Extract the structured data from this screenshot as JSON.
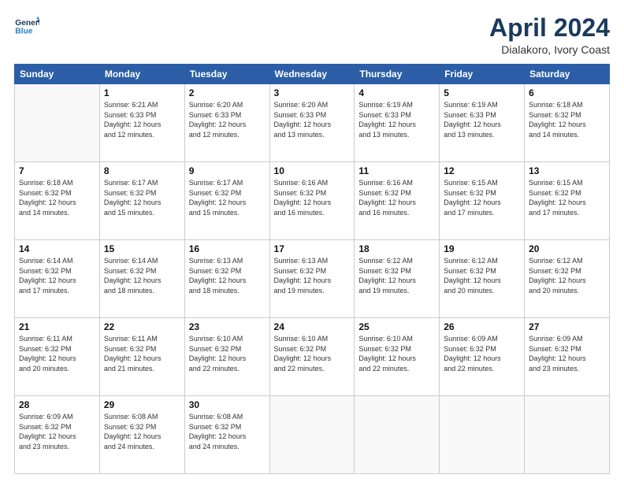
{
  "header": {
    "logo_line1": "General",
    "logo_line2": "Blue",
    "month": "April 2024",
    "location": "Dialakoro, Ivory Coast"
  },
  "weekdays": [
    "Sunday",
    "Monday",
    "Tuesday",
    "Wednesday",
    "Thursday",
    "Friday",
    "Saturday"
  ],
  "weeks": [
    [
      {
        "day": "",
        "info": ""
      },
      {
        "day": "1",
        "info": "Sunrise: 6:21 AM\nSunset: 6:33 PM\nDaylight: 12 hours\nand 12 minutes."
      },
      {
        "day": "2",
        "info": "Sunrise: 6:20 AM\nSunset: 6:33 PM\nDaylight: 12 hours\nand 12 minutes."
      },
      {
        "day": "3",
        "info": "Sunrise: 6:20 AM\nSunset: 6:33 PM\nDaylight: 12 hours\nand 13 minutes."
      },
      {
        "day": "4",
        "info": "Sunrise: 6:19 AM\nSunset: 6:33 PM\nDaylight: 12 hours\nand 13 minutes."
      },
      {
        "day": "5",
        "info": "Sunrise: 6:19 AM\nSunset: 6:33 PM\nDaylight: 12 hours\nand 13 minutes."
      },
      {
        "day": "6",
        "info": "Sunrise: 6:18 AM\nSunset: 6:32 PM\nDaylight: 12 hours\nand 14 minutes."
      }
    ],
    [
      {
        "day": "7",
        "info": "Sunrise: 6:18 AM\nSunset: 6:32 PM\nDaylight: 12 hours\nand 14 minutes."
      },
      {
        "day": "8",
        "info": "Sunrise: 6:17 AM\nSunset: 6:32 PM\nDaylight: 12 hours\nand 15 minutes."
      },
      {
        "day": "9",
        "info": "Sunrise: 6:17 AM\nSunset: 6:32 PM\nDaylight: 12 hours\nand 15 minutes."
      },
      {
        "day": "10",
        "info": "Sunrise: 6:16 AM\nSunset: 6:32 PM\nDaylight: 12 hours\nand 16 minutes."
      },
      {
        "day": "11",
        "info": "Sunrise: 6:16 AM\nSunset: 6:32 PM\nDaylight: 12 hours\nand 16 minutes."
      },
      {
        "day": "12",
        "info": "Sunrise: 6:15 AM\nSunset: 6:32 PM\nDaylight: 12 hours\nand 17 minutes."
      },
      {
        "day": "13",
        "info": "Sunrise: 6:15 AM\nSunset: 6:32 PM\nDaylight: 12 hours\nand 17 minutes."
      }
    ],
    [
      {
        "day": "14",
        "info": "Sunrise: 6:14 AM\nSunset: 6:32 PM\nDaylight: 12 hours\nand 17 minutes."
      },
      {
        "day": "15",
        "info": "Sunrise: 6:14 AM\nSunset: 6:32 PM\nDaylight: 12 hours\nand 18 minutes."
      },
      {
        "day": "16",
        "info": "Sunrise: 6:13 AM\nSunset: 6:32 PM\nDaylight: 12 hours\nand 18 minutes."
      },
      {
        "day": "17",
        "info": "Sunrise: 6:13 AM\nSunset: 6:32 PM\nDaylight: 12 hours\nand 19 minutes."
      },
      {
        "day": "18",
        "info": "Sunrise: 6:12 AM\nSunset: 6:32 PM\nDaylight: 12 hours\nand 19 minutes."
      },
      {
        "day": "19",
        "info": "Sunrise: 6:12 AM\nSunset: 6:32 PM\nDaylight: 12 hours\nand 20 minutes."
      },
      {
        "day": "20",
        "info": "Sunrise: 6:12 AM\nSunset: 6:32 PM\nDaylight: 12 hours\nand 20 minutes."
      }
    ],
    [
      {
        "day": "21",
        "info": "Sunrise: 6:11 AM\nSunset: 6:32 PM\nDaylight: 12 hours\nand 20 minutes."
      },
      {
        "day": "22",
        "info": "Sunrise: 6:11 AM\nSunset: 6:32 PM\nDaylight: 12 hours\nand 21 minutes."
      },
      {
        "day": "23",
        "info": "Sunrise: 6:10 AM\nSunset: 6:32 PM\nDaylight: 12 hours\nand 22 minutes."
      },
      {
        "day": "24",
        "info": "Sunrise: 6:10 AM\nSunset: 6:32 PM\nDaylight: 12 hours\nand 22 minutes."
      },
      {
        "day": "25",
        "info": "Sunrise: 6:10 AM\nSunset: 6:32 PM\nDaylight: 12 hours\nand 22 minutes."
      },
      {
        "day": "26",
        "info": "Sunrise: 6:09 AM\nSunset: 6:32 PM\nDaylight: 12 hours\nand 22 minutes."
      },
      {
        "day": "27",
        "info": "Sunrise: 6:09 AM\nSunset: 6:32 PM\nDaylight: 12 hours\nand 23 minutes."
      }
    ],
    [
      {
        "day": "28",
        "info": "Sunrise: 6:09 AM\nSunset: 6:32 PM\nDaylight: 12 hours\nand 23 minutes."
      },
      {
        "day": "29",
        "info": "Sunrise: 6:08 AM\nSunset: 6:32 PM\nDaylight: 12 hours\nand 24 minutes."
      },
      {
        "day": "30",
        "info": "Sunrise: 6:08 AM\nSunset: 6:32 PM\nDaylight: 12 hours\nand 24 minutes."
      },
      {
        "day": "",
        "info": ""
      },
      {
        "day": "",
        "info": ""
      },
      {
        "day": "",
        "info": ""
      },
      {
        "day": "",
        "info": ""
      }
    ]
  ]
}
